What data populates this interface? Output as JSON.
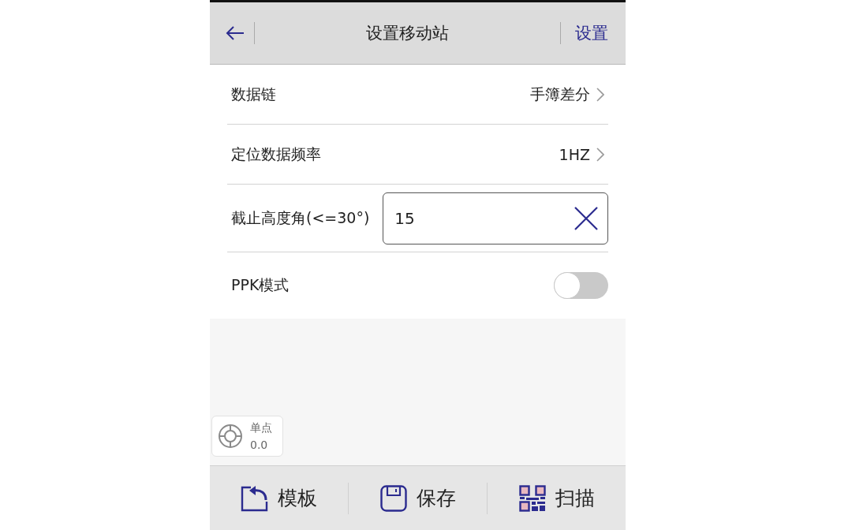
{
  "header": {
    "title": "设置移动站",
    "action": "设置"
  },
  "settings": [
    {
      "kind": "select",
      "label": "数据链",
      "value": "手簿差分"
    },
    {
      "kind": "select",
      "label": "定位数据频率",
      "value": "1HZ"
    },
    {
      "kind": "input",
      "label": "截止高度角(<=30°)",
      "value": "15"
    },
    {
      "kind": "switch",
      "label": "PPK模式",
      "on": false
    }
  ],
  "position_status": {
    "mode": "单点",
    "value": "0.0"
  },
  "toolbar": [
    {
      "label": "模板"
    },
    {
      "label": "保存"
    },
    {
      "label": "扫描"
    }
  ]
}
